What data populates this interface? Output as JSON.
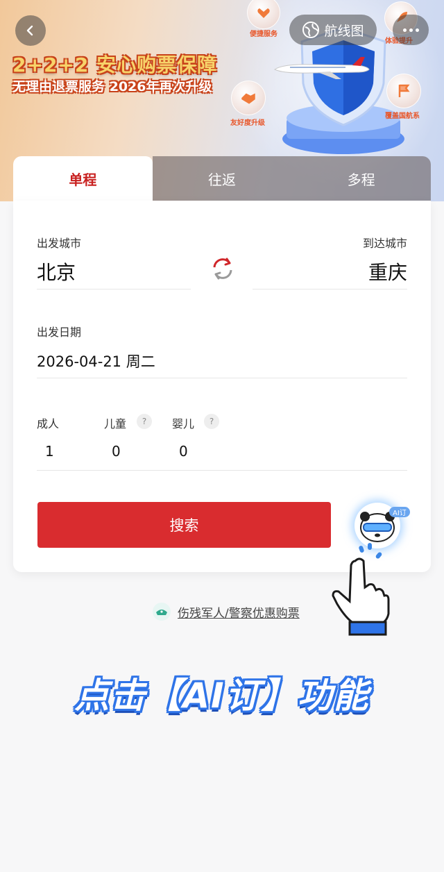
{
  "header": {
    "route_map_label": "航线图",
    "promo_title": "2+2+2 安心购票保障",
    "promo_subtitle": "无理由退票服务 2026年再次升级",
    "badges": [
      "便捷服务",
      "体验提升",
      "友好度升级",
      "覆盖国航系"
    ]
  },
  "tabs": [
    {
      "label": "单程",
      "active": true
    },
    {
      "label": "往返",
      "active": false
    },
    {
      "label": "多程",
      "active": false
    }
  ],
  "form": {
    "depart_label": "出发城市",
    "depart_city": "北京",
    "arrive_label": "到达城市",
    "arrive_city": "重庆",
    "date_label": "出发日期",
    "date_value": "2026-04-21 周二",
    "passengers": [
      {
        "label": "成人",
        "value": "1",
        "help": false
      },
      {
        "label": "儿童",
        "value": "0",
        "help": true
      },
      {
        "label": "婴儿",
        "value": "0",
        "help": true
      }
    ],
    "search_label": "搜索"
  },
  "ai": {
    "tag": "AI订"
  },
  "discount_link": "伤残军人/警察优惠购票",
  "cta_text": "点击【AI订】功能",
  "colors": {
    "accent_red": "#d92c2f",
    "active_tab_text": "#c8201f",
    "cta_blue": "#2f74e8"
  },
  "icons": [
    "back-arrow-icon",
    "globe-icon",
    "more-dots-icon",
    "swap-icon",
    "help-icon",
    "police-cap-icon",
    "pointing-hand-icon",
    "panda-icon"
  ]
}
